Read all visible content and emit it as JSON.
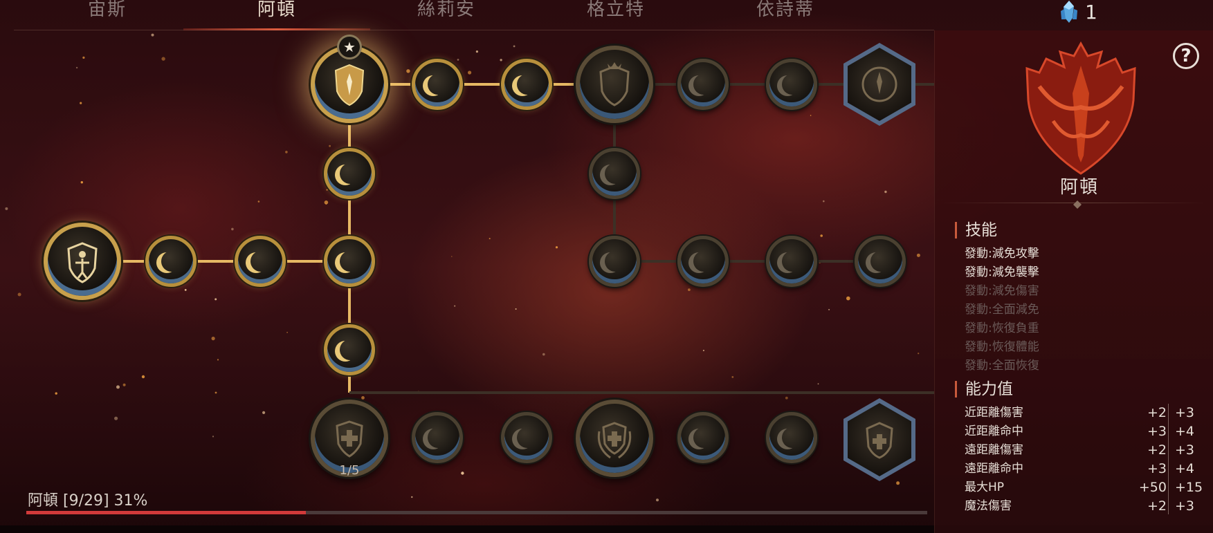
{
  "tabs": [
    {
      "label": "宙斯",
      "active": false
    },
    {
      "label": "阿頓",
      "active": true
    },
    {
      "label": "絲莉安",
      "active": false
    },
    {
      "label": "格立特",
      "active": false
    },
    {
      "label": "依詩蒂",
      "active": false
    }
  ],
  "currency": {
    "icon": "crystal-icon",
    "count": "1"
  },
  "tree": {
    "node_counter": "1/5",
    "progress_label": "阿頓 [9/29] 31%",
    "progress": 0.31
  },
  "panel": {
    "character_name": "阿頓",
    "help_icon": "?",
    "skills_title": "技能",
    "skills": [
      {
        "label": "發動:減免攻擊",
        "unlocked": true
      },
      {
        "label": "發動:減免襲擊",
        "unlocked": true
      },
      {
        "label": "發動:減免傷害",
        "unlocked": false
      },
      {
        "label": "發動:全面減免",
        "unlocked": false
      },
      {
        "label": "發動:恢復負重",
        "unlocked": false
      },
      {
        "label": "發動:恢復體能",
        "unlocked": false
      },
      {
        "label": "發動:全面恢復",
        "unlocked": false
      }
    ],
    "stats_title": "能力值",
    "stats": [
      {
        "name": "近距離傷害",
        "current": "+2",
        "next": "+3"
      },
      {
        "name": "近距離命中",
        "current": "+3",
        "next": "+4"
      },
      {
        "name": "遠距離傷害",
        "current": "+2",
        "next": "+3"
      },
      {
        "name": "遠距離命中",
        "current": "+3",
        "next": "+4"
      },
      {
        "name": "最大HP",
        "current": "+50",
        "next": "+15"
      },
      {
        "name": "魔法傷害",
        "current": "+2",
        "next": "+3"
      }
    ]
  },
  "colors": {
    "accent": "#d23a3a",
    "gold": "#c8a04c",
    "inactive_text": "#6a5a58"
  }
}
